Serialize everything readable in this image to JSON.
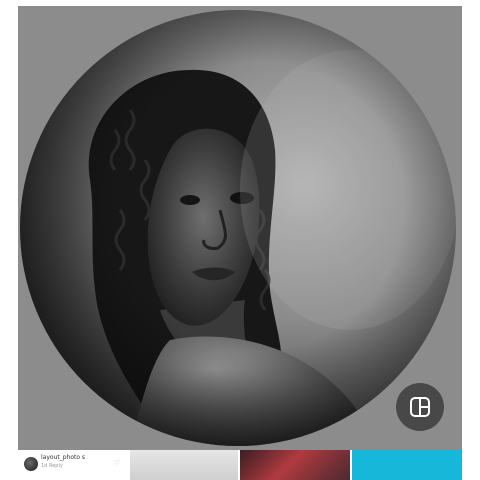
{
  "screen": {
    "background": "#ffffff",
    "viewer_background": "#8c8c8c"
  },
  "photo": {
    "shape": "circle",
    "tone": "black-and-white portrait"
  },
  "layout_button": {
    "icon": "layout-icon"
  },
  "bottom_strip": {
    "post": {
      "username": "layout_photo s",
      "meta": "1d   Reply",
      "like_icon": "heart-icon"
    },
    "thumbnails": [
      {
        "color": "#d9d9d9"
      },
      {
        "color": "#8a2b33"
      },
      {
        "color": "#16b7d8"
      }
    ]
  }
}
